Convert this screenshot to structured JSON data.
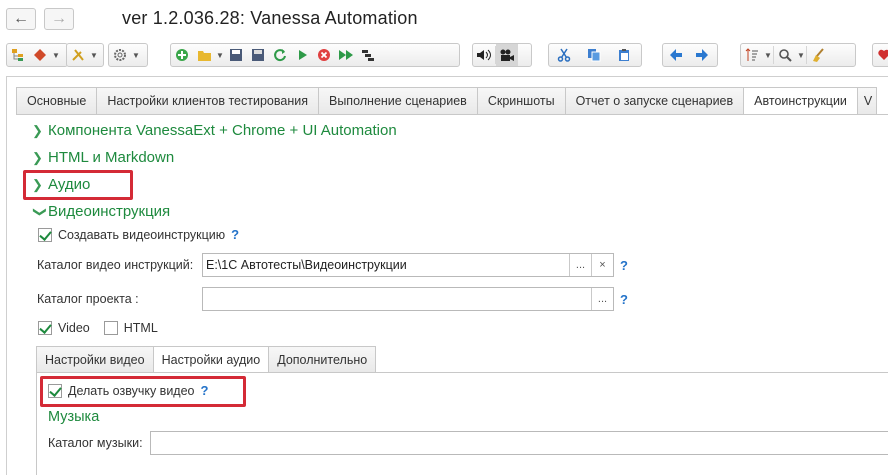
{
  "window": {
    "title": "ver 1.2.036.28: Vanessa Automation"
  },
  "nav": {
    "back": "←",
    "forward": "→"
  },
  "tabs": [
    {
      "label": "Основные"
    },
    {
      "label": "Настройки клиентов тестирования"
    },
    {
      "label": "Выполнение сценариев"
    },
    {
      "label": "Скриншоты"
    },
    {
      "label": "Отчет о запуске сценариев"
    },
    {
      "label": "Автоинструкции"
    },
    {
      "label": "V"
    }
  ],
  "groups": {
    "vanessaext": "Компонента VanessaExt + Chrome + UI Automation",
    "html": "HTML и Markdown",
    "audio": "Аудио",
    "video": "Видеоинструкция"
  },
  "video": {
    "create_label": "Создавать видеоинструкцию",
    "create_checked": true,
    "catalog_label": "Каталог видео инструкций:",
    "catalog_value": "E:\\1С Автотесты\\Видеоинструкции",
    "project_label": "Каталог проекта :",
    "project_value": "",
    "format_video_label": "Video",
    "format_html_label": "HTML",
    "help": "?"
  },
  "subtabs": [
    {
      "label": "Настройки видео"
    },
    {
      "label": "Настройки аудио"
    },
    {
      "label": "Дополнительно"
    }
  ],
  "audio_settings": {
    "voiceover_label": "Делать озвучку видео",
    "voiceover_checked": true,
    "music_header": "Музыка",
    "music_catalog_label": "Каталог музыки:",
    "music_catalog_value": ""
  },
  "icons": {
    "choose": "...",
    "clear": "×",
    "chevron_right": "›",
    "chevron_down": "⌄"
  },
  "colors": {
    "group_green": "#1e8a3e",
    "highlight_red": "#d42a36",
    "help_blue": "#2473c9"
  }
}
